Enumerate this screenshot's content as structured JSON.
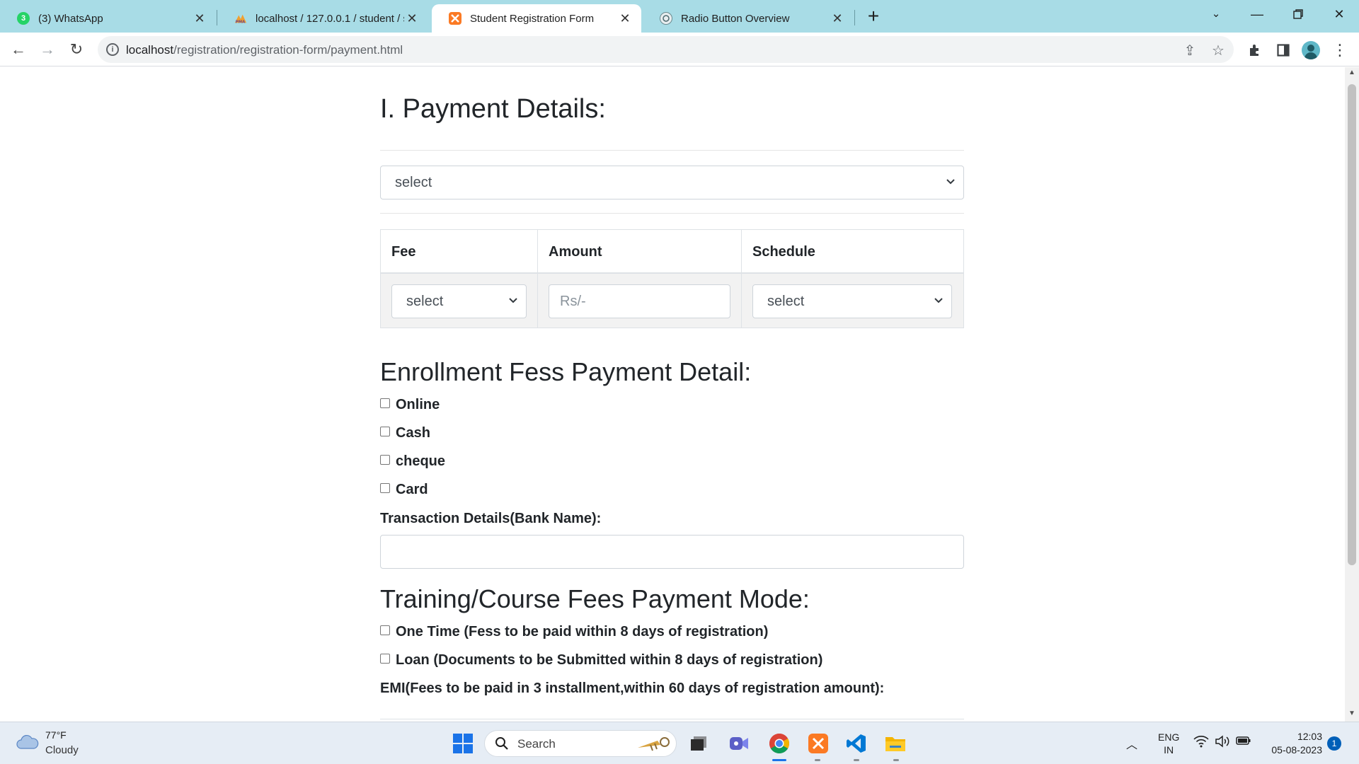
{
  "browser": {
    "tabs": [
      {
        "title": "(3) WhatsApp",
        "favicon_badge": "3",
        "favicon_color": "#25d366"
      },
      {
        "title": "localhost / 127.0.0.1 / student / s",
        "favicon_color": "#f0a030"
      },
      {
        "title": "Student Registration Form",
        "favicon_color": "#fb7a24",
        "active": true
      },
      {
        "title": "Radio Button Overview",
        "favicon_color": "#6b8a8f"
      }
    ],
    "url_host": "localhost",
    "url_path": "/registration/registration-form/payment.html"
  },
  "page": {
    "title": "I. Payment Details:",
    "plan_select": "select",
    "fee_table": {
      "headers": [
        "Fee",
        "Amount",
        "Schedule"
      ],
      "fee_select": "select",
      "amount_placeholder": "Rs/-",
      "schedule_select": "select"
    },
    "enrollment": {
      "heading": "Enrollment Fess Payment Detail:",
      "options": [
        "Online",
        "Cash",
        "cheque",
        "Card"
      ],
      "transaction_label": "Transaction Details(Bank Name):"
    },
    "training": {
      "heading": "Training/Course Fees Payment Mode:",
      "options": [
        "One Time (Fess to be paid within 8 days of registration)",
        "Loan (Documents to be Submitted within 8 days of registration)"
      ],
      "emi_label": "EMI(Fees to be paid in 3 installment,within 60 days of registration amount):"
    }
  },
  "taskbar": {
    "weather_temp": "77°F",
    "weather_cond": "Cloudy",
    "search_text": "Search",
    "lang_top": "ENG",
    "lang_bottom": "IN",
    "time": "12:03",
    "date": "05-08-2023",
    "notifications": "1"
  },
  "colors": {
    "tabstrip": "#a8dce6",
    "taskbar": "#e6edf5",
    "accent": "#005fb8"
  }
}
